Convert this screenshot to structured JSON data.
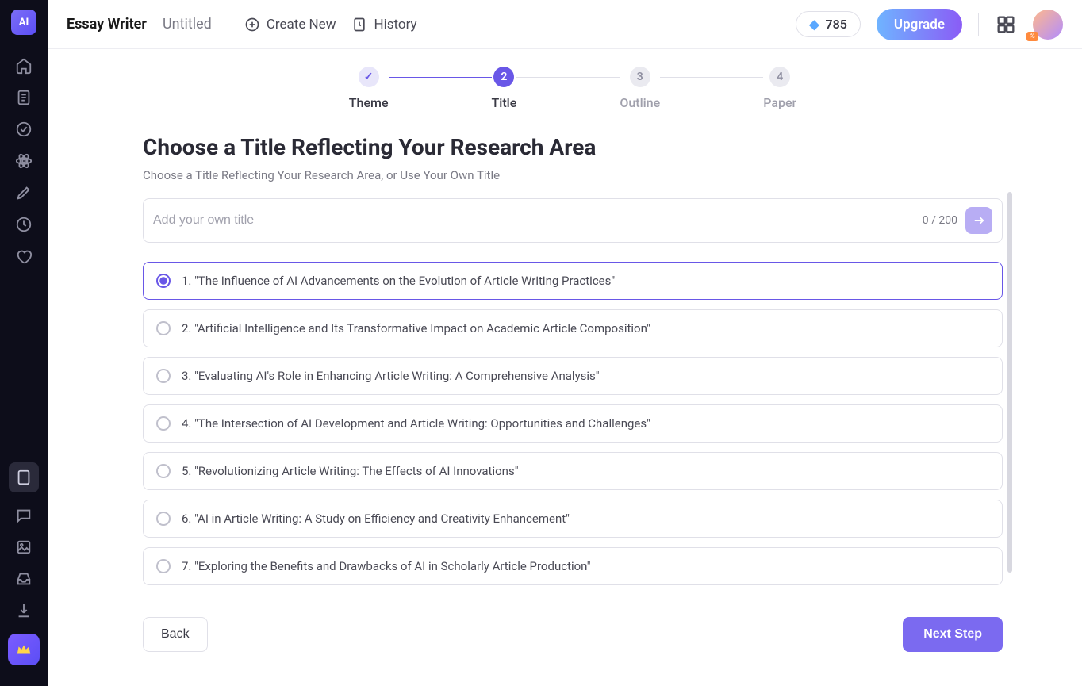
{
  "header": {
    "app_title": "Essay Writer",
    "doc_title": "Untitled",
    "create_new": "Create New",
    "history": "History",
    "credits": "785",
    "upgrade": "Upgrade",
    "avatar_badge": "%"
  },
  "steps": [
    {
      "label": "Theme",
      "state": "done",
      "mark": "✓"
    },
    {
      "label": "Title",
      "state": "current",
      "mark": "2"
    },
    {
      "label": "Outline",
      "state": "pending",
      "mark": "3"
    },
    {
      "label": "Paper",
      "state": "pending",
      "mark": "4"
    }
  ],
  "page": {
    "heading": "Choose a Title Reflecting Your Research Area",
    "subheading": "Choose a Title Reflecting Your Research Area, or Use Your Own Title",
    "input_placeholder": "Add your own title",
    "char_count": "0 / 200"
  },
  "options": [
    {
      "text": "1. \"The Influence of AI Advancements on the Evolution of Article Writing Practices\"",
      "selected": true
    },
    {
      "text": "2. \"Artificial Intelligence and Its Transformative Impact on Academic Article Composition\"",
      "selected": false
    },
    {
      "text": "3. \"Evaluating AI's Role in Enhancing Article Writing: A Comprehensive Analysis\"",
      "selected": false
    },
    {
      "text": "4. \"The Intersection of AI Development and Article Writing: Opportunities and Challenges\"",
      "selected": false
    },
    {
      "text": "5. \"Revolutionizing Article Writing: The Effects of AI Innovations\"",
      "selected": false
    },
    {
      "text": "6. \"AI in Article Writing: A Study on Efficiency and Creativity Enhancement\"",
      "selected": false
    },
    {
      "text": "7. \"Exploring the Benefits and Drawbacks of AI in Scholarly Article Production\"",
      "selected": false
    }
  ],
  "footer": {
    "back": "Back",
    "next": "Next Step"
  }
}
